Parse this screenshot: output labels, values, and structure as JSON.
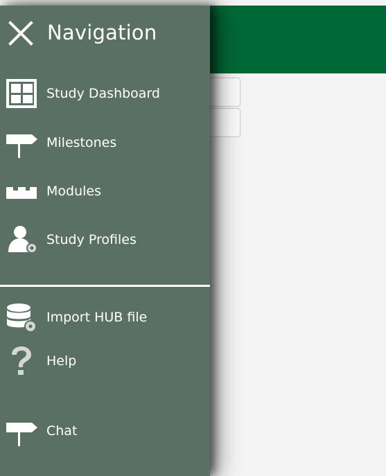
{
  "drawer": {
    "title": "Navigation",
    "close_icon": "close-icon",
    "primary_items": [
      {
        "label": "Study Dashboard",
        "icon": "dashboard-grid-icon"
      },
      {
        "label": "Milestones",
        "icon": "signpost-icon"
      },
      {
        "label": "Modules",
        "icon": "building-blocks-icon"
      },
      {
        "label": "Study Profiles",
        "icon": "user-settings-icon"
      }
    ],
    "secondary_items": [
      {
        "label": "Import HUB file",
        "icon": "database-settings-icon"
      },
      {
        "label": "Help",
        "icon": "question-mark-icon"
      },
      {
        "label": "Chat",
        "icon": "signpost-icon"
      }
    ]
  },
  "colors": {
    "drawer_background": "#5b7064",
    "header_green": "#006837",
    "text": "#ffffff",
    "icon_light": "#ffffff",
    "icon_gray": "#d6d6d6",
    "page_background": "#f4f4f4"
  }
}
